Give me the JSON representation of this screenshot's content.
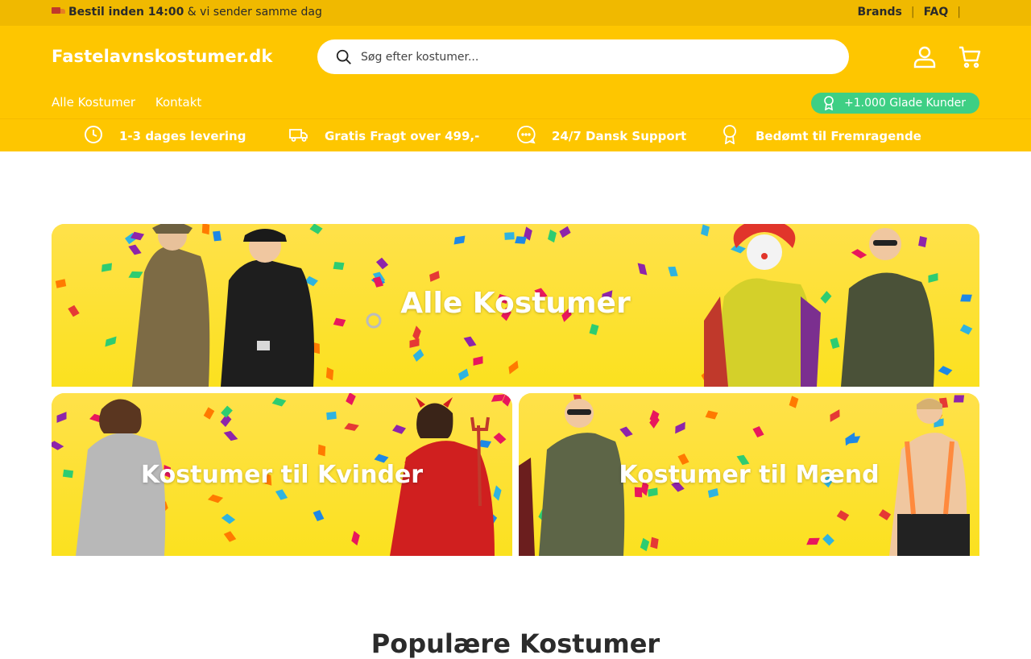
{
  "topbar": {
    "promo_bold": "Bestil inden 14:00",
    "promo_rest": " & vi sender samme dag",
    "links": [
      "Brands",
      "FAQ"
    ],
    "separator": "|",
    "bg_color": "#f0b900"
  },
  "header": {
    "logo": "Fastelavnskostumer.dk",
    "search_placeholder": "Søg efter kostumer...",
    "account_icon": "user-icon",
    "cart_icon": "cart-icon",
    "bg_color": "#fec600"
  },
  "nav": {
    "items": [
      "Alle Kostumer",
      "Kontakt"
    ]
  },
  "badge": {
    "label": "+1.000 Glade Kunder",
    "icon": "award-icon",
    "color": "#3ecf84"
  },
  "usp": [
    {
      "icon": "clock-icon",
      "label": "1-3 dages levering"
    },
    {
      "icon": "truck-icon",
      "label": "Gratis Fragt over 499,-"
    },
    {
      "icon": "chat-icon",
      "label": "24/7 Dansk Support"
    },
    {
      "icon": "award-icon",
      "label": "Bedømt til Fremragende"
    }
  ],
  "banners": [
    {
      "label": "Alle Kostumer"
    },
    {
      "label": "Kostumer til Kvinder"
    },
    {
      "label": "Kostumer til Mænd"
    }
  ],
  "section": {
    "title": "Populære Kostumer"
  }
}
